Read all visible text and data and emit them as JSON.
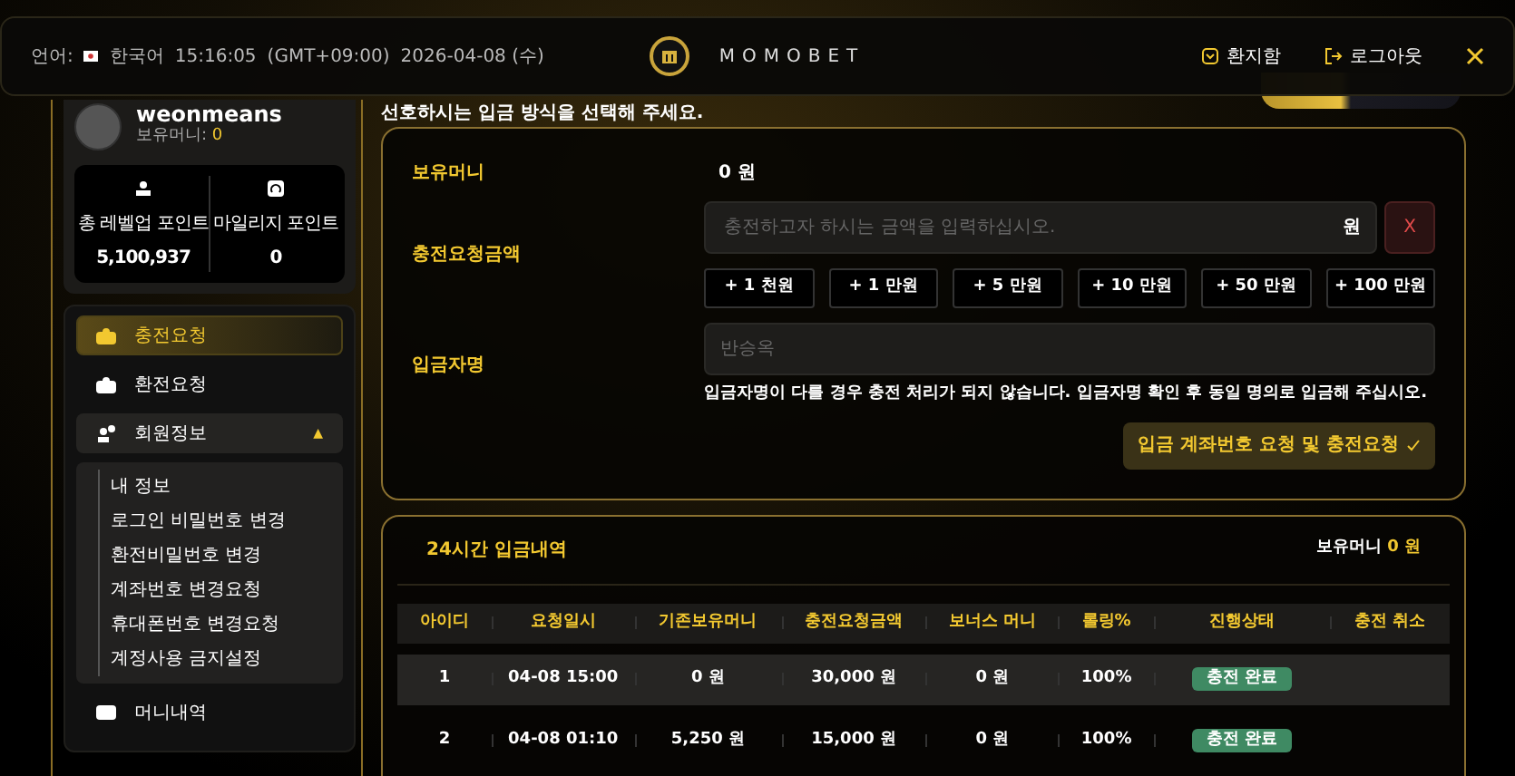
{
  "header": {
    "language_label": "언어:",
    "language": "한국어",
    "time": "15:16:05",
    "timezone": "(GMT+09:00)",
    "date": "2026-04-08 (수)",
    "logo_text": "MOMOBET",
    "actions": [
      {
        "label": "환지함"
      },
      {
        "label": "로그아웃"
      }
    ]
  },
  "profile": {
    "username": "weonmeans",
    "money_label": "보유머니:",
    "money": "0",
    "stats": [
      {
        "label": "총 레벨업 포인트",
        "value": "5,100,937"
      },
      {
        "label": "마일리지 포인트",
        "value": "0"
      }
    ]
  },
  "sidebar": {
    "items": [
      {
        "label": "충전요청",
        "selected": true,
        "expanded": false
      },
      {
        "label": "환전요청",
        "selected": false,
        "expanded": false
      },
      {
        "label": "회원정보",
        "selected": false,
        "expanded": true,
        "caret": "▲",
        "children": [
          {
            "label": "내 정보"
          },
          {
            "label": "로그인 비밀번호 변경"
          },
          {
            "label": "환전비밀번호 변경"
          },
          {
            "label": "계좌번호 변경요청"
          },
          {
            "label": "휴대폰번호 변경요청"
          },
          {
            "label": "계정사용 금지설정"
          }
        ]
      },
      {
        "label": "머니내역",
        "selected": false,
        "expanded": false
      }
    ]
  },
  "subtitle": "선호하시는 입금 방식을 선택해 주세요.",
  "form": {
    "balance_label": "보유머니",
    "balance": "0 원",
    "amount_label": "충전요청금액",
    "amount_placeholder": "충전하고자 하시는 금액을 입력하십시오.",
    "amount_unit": "원",
    "clear_button": "X",
    "quick_amounts": [
      "+ 1 천원",
      "+ 1 만원",
      "+ 5 만원",
      "+ 10 만원",
      "+ 50 만원",
      "+ 100 만원"
    ],
    "depositor_label": "입금자명",
    "depositor_placeholder": "반승옥",
    "notice": "입금자명이 다를 경우 충전 처리가 되지 않습니다. 입금자명 확인 후 동일 명의로 입금해 주십시오.",
    "submit": "입금 계좌번호 요청 및 충전요청"
  },
  "history": {
    "title": "24시간 입금내역",
    "balance_label": "보유머니",
    "balance": "0 원",
    "columns": [
      "아이디",
      "요청일시",
      "기존보유머니",
      "충전요청금액",
      "보너스 머니",
      "롤링%",
      "진행상태",
      "충전 취소"
    ],
    "rows": [
      {
        "cells": [
          "1",
          "04-08 15:00",
          "0 원",
          "30,000 원",
          "0 원",
          "100%"
        ],
        "status": "충전 완료",
        "highlighted": true
      },
      {
        "cells": [
          "2",
          "04-08 01:10",
          "5,250 원",
          "15,000 원",
          "0 원",
          "100%"
        ],
        "status": "충전 완료",
        "highlighted": false
      }
    ]
  }
}
